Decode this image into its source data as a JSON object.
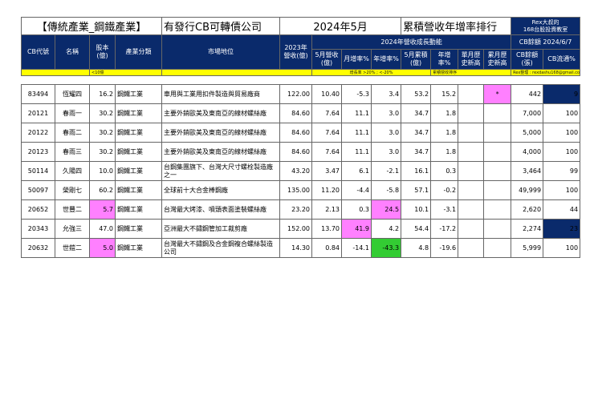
{
  "title": {
    "category": "【傳統產業_鋼鐵產業】",
    "subject": "有發行CB可轉債公司",
    "month": "2024年5月",
    "report": "累積營收年增率排行",
    "brand_line1": "Rex大叔的",
    "brand_line2": "168台股投資教室"
  },
  "headers": {
    "cb_code": "CB代號",
    "name": "名稱",
    "capital": "股本(億)",
    "industry": "產業分類",
    "market_position": "市場地位",
    "revenue_2023": "2023年營收(億)",
    "growth_group": "2024年營收成長動能",
    "cb_balance_group": "CB餘額 2024/6/7",
    "may_revenue": "5月營收(億)",
    "mom": "月增率%",
    "yoy": "年增率%",
    "may_cum": "5月累積(億)",
    "cum_yoy": "年增率%",
    "single_month_high": "單月歷史新高",
    "cum_high": "累月歷史新高",
    "cb_balance": "CB餘額(張)",
    "cb_circulation": "CB流通%"
  },
  "notes": {
    "capital_note": "<10億",
    "growth_note": "增長率 >20% ; <-20%",
    "cum_note": "累積營收排序",
    "credit": "Rex整理 : rexdashu168@gmail.com"
  },
  "rows": [
    {
      "code": "83494",
      "name": "恆耀四",
      "capital": "16.2",
      "industry": "鋼鐵工業",
      "market": "車用與工業用扣件製造與貿易廠商",
      "rev2023": "122.00",
      "may": "10.40",
      "mom": "-5.3",
      "yoy": "3.4",
      "cum": "53.2",
      "cumyoy": "15.2",
      "single_high": "",
      "cum_high": "*",
      "cb_bal": "442",
      "cb_pct": "9"
    },
    {
      "code": "20121",
      "name": "春雨一",
      "capital": "30.2",
      "industry": "鋼鐵工業",
      "market": "主要外銷歐美及東南亞的線材螺絲廠",
      "rev2023": "84.60",
      "may": "7.64",
      "mom": "11.1",
      "yoy": "3.0",
      "cum": "34.7",
      "cumyoy": "1.8",
      "single_high": "",
      "cum_high": "",
      "cb_bal": "7,000",
      "cb_pct": "100"
    },
    {
      "code": "20122",
      "name": "春雨二",
      "capital": "30.2",
      "industry": "鋼鐵工業",
      "market": "主要外銷歐美及東南亞的線材螺絲廠",
      "rev2023": "84.60",
      "may": "7.64",
      "mom": "11.1",
      "yoy": "3.0",
      "cum": "34.7",
      "cumyoy": "1.8",
      "single_high": "",
      "cum_high": "",
      "cb_bal": "5,000",
      "cb_pct": "100"
    },
    {
      "code": "20123",
      "name": "春雨三",
      "capital": "30.2",
      "industry": "鋼鐵工業",
      "market": "主要外銷歐美及東南亞的線材螺絲廠",
      "rev2023": "84.60",
      "may": "7.64",
      "mom": "11.1",
      "yoy": "3.0",
      "cum": "34.7",
      "cumyoy": "1.8",
      "single_high": "",
      "cum_high": "",
      "cb_bal": "4,000",
      "cb_pct": "100"
    },
    {
      "code": "50114",
      "name": "久陽四",
      "capital": "10.0",
      "industry": "鋼鐵工業",
      "market": "台鋼集團旗下、台灣大尺寸螺栓製造廠之一",
      "rev2023": "43.20",
      "may": "3.47",
      "mom": "6.1",
      "yoy": "-2.1",
      "cum": "16.1",
      "cumyoy": "0.3",
      "single_high": "",
      "cum_high": "",
      "cb_bal": "3,464",
      "cb_pct": "99"
    },
    {
      "code": "50097",
      "name": "榮剛七",
      "capital": "60.2",
      "industry": "鋼鐵工業",
      "market": "全球前十大合金棒鋼廠",
      "rev2023": "135.00",
      "may": "11.20",
      "mom": "-4.4",
      "yoy": "-5.8",
      "cum": "57.1",
      "cumyoy": "-0.2",
      "single_high": "",
      "cum_high": "",
      "cb_bal": "49,999",
      "cb_pct": "100"
    },
    {
      "code": "20652",
      "name": "世豐二",
      "capital": "5.7",
      "industry": "鋼鐵工業",
      "market": "台灣最大烤漆、噴頭表面塗裝螺絲廠",
      "rev2023": "23.20",
      "may": "2.13",
      "mom": "0.3",
      "yoy": "24.5",
      "cum": "10.1",
      "cumyoy": "-3.1",
      "single_high": "",
      "cum_high": "",
      "cb_bal": "2,620",
      "cb_pct": "44"
    },
    {
      "code": "20343",
      "name": "允強三",
      "capital": "47.0",
      "industry": "鋼鐵工業",
      "market": "亞洲最大不鏽鋼管加工裁剪廠",
      "rev2023": "152.00",
      "may": "13.70",
      "mom": "41.9",
      "yoy": "4.2",
      "cum": "54.4",
      "cumyoy": "-17.2",
      "single_high": "",
      "cum_high": "",
      "cb_bal": "2,274",
      "cb_pct": "23"
    },
    {
      "code": "20632",
      "name": "世鎧二",
      "capital": "5.0",
      "industry": "鋼鐵工業",
      "market": "台灣最大不鏽鋼及合金鋼複合螺絲製造公司",
      "rev2023": "14.30",
      "may": "0.84",
      "mom": "-14.1",
      "yoy": "-43.3",
      "cum": "4.8",
      "cumyoy": "-19.6",
      "single_high": "",
      "cum_high": "",
      "cb_bal": "5,999",
      "cb_pct": "100"
    }
  ]
}
